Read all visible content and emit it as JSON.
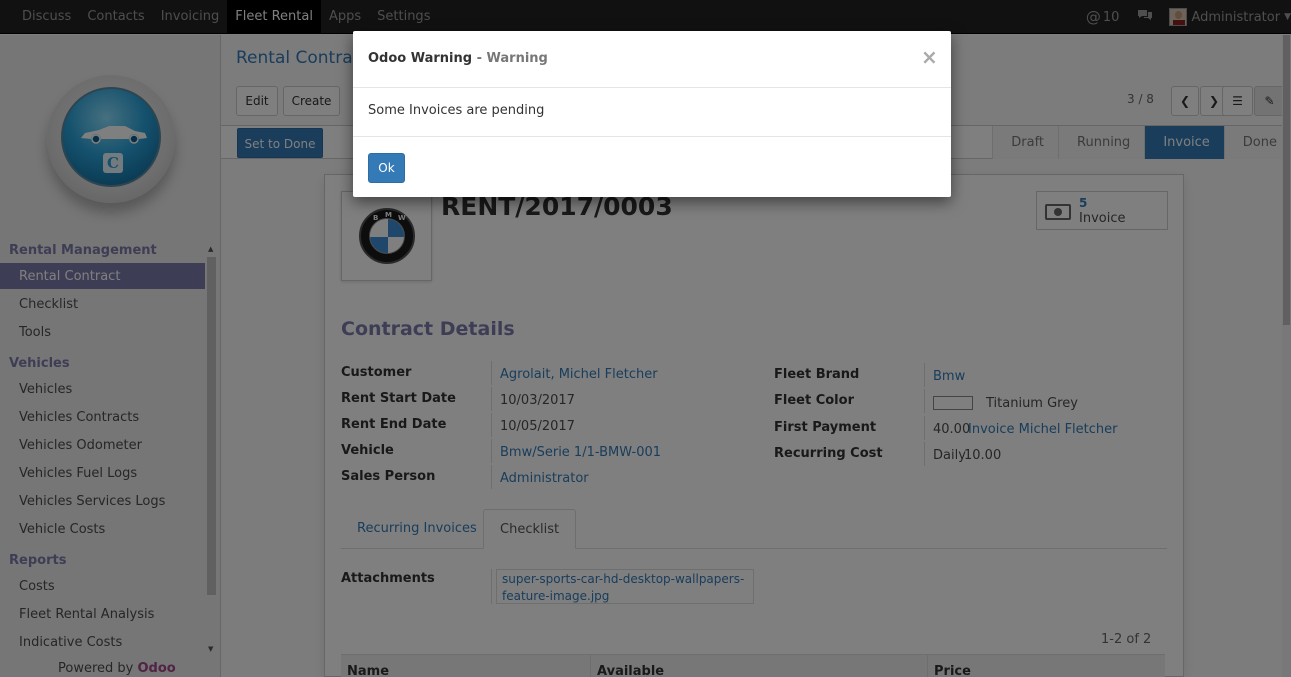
{
  "topbar": {
    "menu": [
      "Discuss",
      "Contacts",
      "Invoicing",
      "Fleet Rental",
      "Apps",
      "Settings"
    ],
    "active_index": 3,
    "mention_count": "10",
    "user": "Administrator"
  },
  "sidebar": {
    "sections": [
      {
        "title": "Rental Management",
        "items": [
          "Rental Contract",
          "Checklist",
          "Tools"
        ]
      },
      {
        "title": "Vehicles",
        "items": [
          "Vehicles",
          "Vehicles Contracts",
          "Vehicles Odometer",
          "Vehicles Fuel Logs",
          "Vehicles Services Logs",
          "Vehicle Costs"
        ]
      },
      {
        "title": "Reports",
        "items": [
          "Costs",
          "Fleet Rental Analysis",
          "Indicative Costs"
        ]
      }
    ],
    "active_item": "Rental Contract",
    "powered_by": "Powered by",
    "powered_brand": "Odoo"
  },
  "control": {
    "breadcrumb": "Rental Contract",
    "edit_label": "Edit",
    "create_label": "Create",
    "pager": "3 / 8"
  },
  "statusbar": {
    "action_label": "Set to Done",
    "stages": [
      "Draft",
      "Running",
      "Invoice",
      "Done"
    ],
    "active_stage": "Invoice"
  },
  "record": {
    "name": "RENT/2017/0003",
    "logo_letters": [
      "B",
      "M",
      "W"
    ],
    "smart_button": {
      "count": "5",
      "label": "Invoice"
    },
    "section_title": "Contract Details",
    "left_fields": [
      {
        "label": "Customer",
        "value": "Agrolait, Michel Fletcher",
        "link": true
      },
      {
        "label": "Rent Start Date",
        "value": "10/03/2017",
        "link": false
      },
      {
        "label": "Rent End Date",
        "value": "10/05/2017",
        "link": false
      },
      {
        "label": "Vehicle",
        "value": "Bmw/Serie 1/1-BMW-001",
        "link": true
      },
      {
        "label": "Sales Person",
        "value": "Administrator",
        "link": true
      }
    ],
    "right_fields": {
      "fleet_brand_label": "Fleet Brand",
      "fleet_brand": "Bmw",
      "fleet_color_label": "Fleet Color",
      "fleet_color": "Titanium Grey",
      "first_payment_label": "First Payment",
      "first_payment_amount": "40.00",
      "first_payment_invoice": "Invoice Michel Fletcher",
      "recurring_cost_label": "Recurring Cost",
      "recurring_period": "Daily",
      "recurring_amount": "10.00"
    },
    "tabs": [
      "Recurring Invoices",
      "Checklist"
    ],
    "active_tab": "Checklist",
    "attachments_label": "Attachments",
    "attachment_line1": "super-sports-car-hd-desktop-wallpapers-",
    "attachment_line2": "feature-image.jpg",
    "list_pager": "1-2 of 2",
    "columns": [
      "Name",
      "Available",
      "Price"
    ]
  },
  "modal": {
    "title": "Odoo Warning",
    "subtitle": "- Warning",
    "close": "×",
    "message": "Some Invoices are pending",
    "ok_label": "Ok"
  },
  "colors": {
    "primary": "#337ab7",
    "sidebar_accent": "#7c7bad",
    "topbar": "#222222",
    "odoo_brand": "#a24689"
  }
}
